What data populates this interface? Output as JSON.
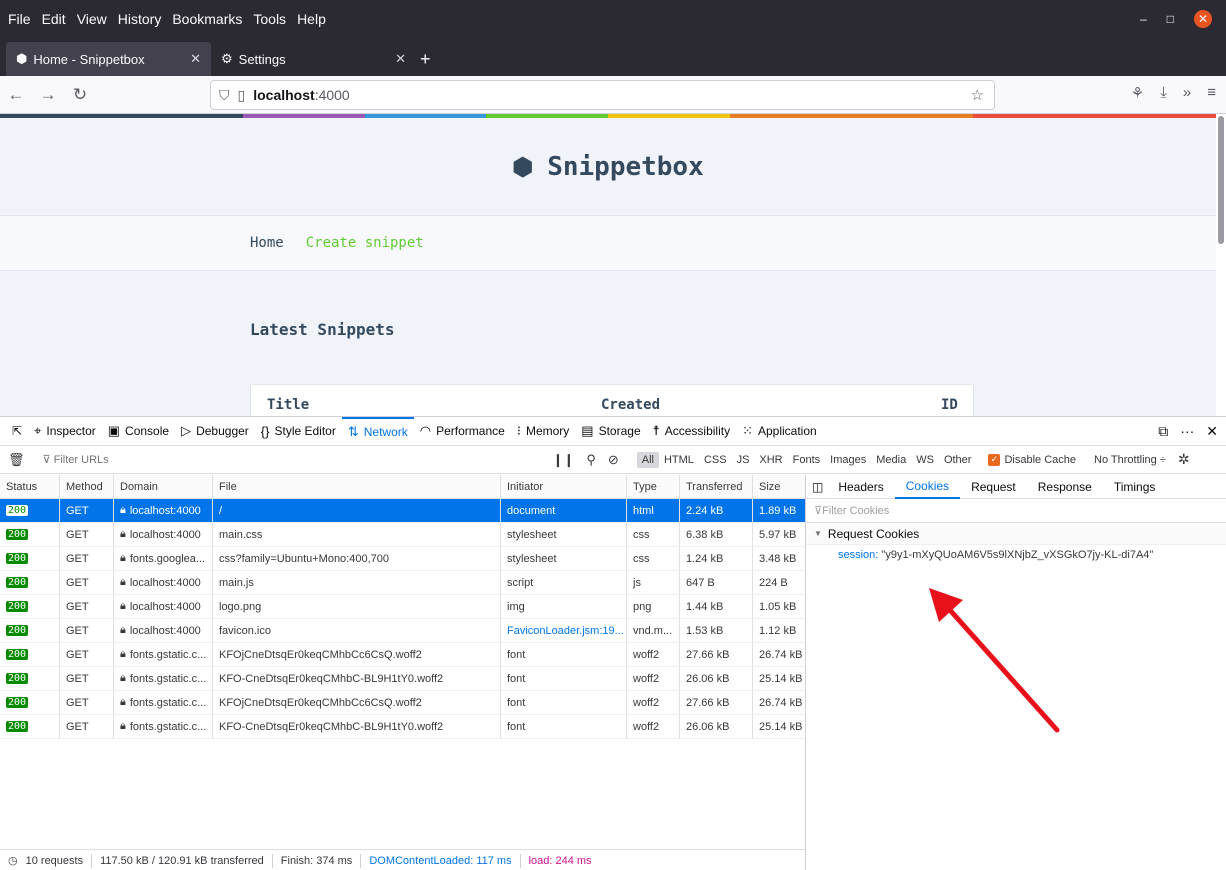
{
  "menu": [
    "File",
    "Edit",
    "View",
    "History",
    "Bookmarks",
    "Tools",
    "Help"
  ],
  "tabs": [
    {
      "label": "Home - Snippetbox",
      "icon": "snippetbox-icon"
    },
    {
      "label": "Settings",
      "icon": "gear-icon"
    }
  ],
  "urlbar": {
    "host": "localhost",
    "port": ":4000"
  },
  "site": {
    "brand": "Snippetbox",
    "nav": {
      "home": "Home",
      "create": "Create snippet"
    },
    "heading": "Latest Snippets",
    "table": {
      "title": "Title",
      "created": "Created",
      "id": "ID"
    }
  },
  "devtools": {
    "tabs": [
      "Inspector",
      "Console",
      "Debugger",
      "Style Editor",
      "Network",
      "Performance",
      "Memory",
      "Storage",
      "Accessibility",
      "Application"
    ],
    "active_tab": "Network",
    "filter_placeholder": "Filter URLs",
    "type_filters": [
      "All",
      "HTML",
      "CSS",
      "JS",
      "XHR",
      "Fonts",
      "Images",
      "Media",
      "WS",
      "Other"
    ],
    "disable_cache": "Disable Cache",
    "throttling": "No Throttling ÷",
    "columns": {
      "status": "Status",
      "method": "Method",
      "domain": "Domain",
      "file": "File",
      "initiator": "Initiator",
      "type": "Type",
      "transferred": "Transferred",
      "size": "Size"
    },
    "requests": [
      {
        "status": "200",
        "method": "GET",
        "domain": "localhost:4000",
        "file": "/",
        "initiator": "document",
        "type": "html",
        "transferred": "2.24 kB",
        "size": "1.89 kB"
      },
      {
        "status": "200",
        "method": "GET",
        "domain": "localhost:4000",
        "file": "main.css",
        "initiator": "stylesheet",
        "type": "css",
        "transferred": "6.38 kB",
        "size": "5.97 kB"
      },
      {
        "status": "200",
        "method": "GET",
        "domain": "fonts.googlea...",
        "file": "css?family=Ubuntu+Mono:400,700",
        "initiator": "stylesheet",
        "type": "css",
        "transferred": "1.24 kB",
        "size": "3.48 kB"
      },
      {
        "status": "200",
        "method": "GET",
        "domain": "localhost:4000",
        "file": "main.js",
        "initiator": "script",
        "type": "js",
        "transferred": "647 B",
        "size": "224 B"
      },
      {
        "status": "200",
        "method": "GET",
        "domain": "localhost:4000",
        "file": "logo.png",
        "initiator": "img",
        "type": "png",
        "transferred": "1.44 kB",
        "size": "1.05 kB"
      },
      {
        "status": "200",
        "method": "GET",
        "domain": "localhost:4000",
        "file": "favicon.ico",
        "initiator": "FaviconLoader.jsm:19...",
        "type": "vnd.m...",
        "transferred": "1.53 kB",
        "size": "1.12 kB"
      },
      {
        "status": "200",
        "method": "GET",
        "domain": "fonts.gstatic.c...",
        "file": "KFOjCneDtsqEr0keqCMhbCc6CsQ.woff2",
        "initiator": "font",
        "type": "woff2",
        "transferred": "27.66 kB",
        "size": "26.74 kB"
      },
      {
        "status": "200",
        "method": "GET",
        "domain": "fonts.gstatic.c...",
        "file": "KFO-CneDtsqEr0keqCMhbC-BL9H1tY0.woff2",
        "initiator": "font",
        "type": "woff2",
        "transferred": "26.06 kB",
        "size": "25.14 kB"
      },
      {
        "status": "200",
        "method": "GET",
        "domain": "fonts.gstatic.c...",
        "file": "KFOjCneDtsqEr0keqCMhbCc6CsQ.woff2",
        "initiator": "font",
        "type": "woff2",
        "transferred": "27.66 kB",
        "size": "26.74 kB"
      },
      {
        "status": "200",
        "method": "GET",
        "domain": "fonts.gstatic.c...",
        "file": "KFO-CneDtsqEr0keqCMhbC-BL9H1tY0.woff2",
        "initiator": "font",
        "type": "woff2",
        "transferred": "26.06 kB",
        "size": "25.14 kB"
      }
    ],
    "status": {
      "requests": "10 requests",
      "transferred": "117.50 kB / 120.91 kB transferred",
      "finish": "Finish: 374 ms",
      "dom": "DOMContentLoaded: 117 ms",
      "load": "load: 244 ms"
    },
    "side_tabs": [
      "Headers",
      "Cookies",
      "Request",
      "Response",
      "Timings"
    ],
    "side_active": "Cookies",
    "cookie_filter": "Filter Cookies",
    "request_cookies_label": "Request Cookies",
    "cookie": {
      "name": "session:",
      "value": "\"y9y1-mXyQUoAM6V5s9lXNjbZ_vXSGkO7jy-KL-di7A4\""
    }
  },
  "colors": {
    "accent": "#0074e8",
    "status_ok": "#058b00",
    "arrow": "#e8111b",
    "rainbow": [
      "#34495e",
      "#34495e",
      "#9b59b6",
      "#3498db",
      "#2ecc71",
      "#f1c40f",
      "#e67e22",
      "#e67e22",
      "#e74c3c"
    ]
  }
}
